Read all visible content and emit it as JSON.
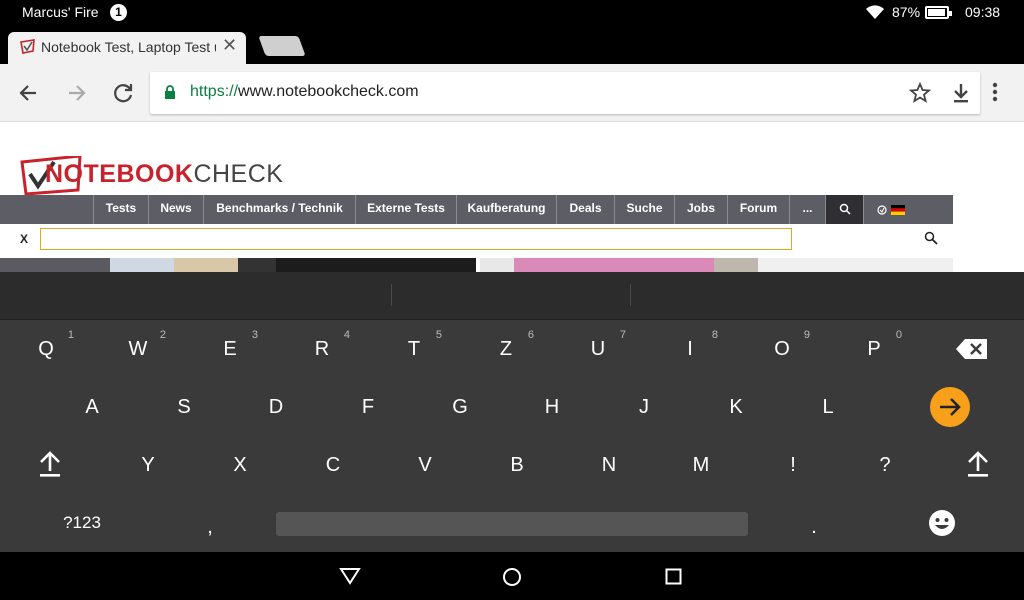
{
  "status_bar": {
    "device_name": "Marcus' Fire",
    "notification_count": "1",
    "battery": "87%",
    "time": "09:38"
  },
  "tabs": {
    "active_title": "Notebook Test, Laptop Test u",
    "close_symbol": "✕"
  },
  "toolbar": {
    "url_scheme": "https://",
    "url_host": "www.notebookcheck.com"
  },
  "site": {
    "logo_red": "NOTEBOOK",
    "logo_grey": "CHECK",
    "nav_items": [
      "Tests",
      "News",
      "Benchmarks / Technik",
      "Externe Tests",
      "Kaufberatung",
      "Deals",
      "Suche",
      "Jobs",
      "Forum",
      "..."
    ],
    "search_close": "X",
    "search_value": ""
  },
  "keyboard": {
    "row1": [
      {
        "key": "Q",
        "num": "1"
      },
      {
        "key": "W",
        "num": "2"
      },
      {
        "key": "E",
        "num": "3"
      },
      {
        "key": "R",
        "num": "4"
      },
      {
        "key": "T",
        "num": "5"
      },
      {
        "key": "Z",
        "num": "6"
      },
      {
        "key": "U",
        "num": "7"
      },
      {
        "key": "I",
        "num": "8"
      },
      {
        "key": "O",
        "num": "9"
      },
      {
        "key": "P",
        "num": "0"
      }
    ],
    "row2": [
      "A",
      "S",
      "D",
      "F",
      "G",
      "H",
      "J",
      "K",
      "L"
    ],
    "row3": [
      "Y",
      "X",
      "C",
      "V",
      "B",
      "N",
      "M",
      "!",
      "?"
    ],
    "symbols_label": "?123",
    "comma": ",",
    "period": "."
  },
  "colors": {
    "accent_enter": "#f9a01b",
    "url_scheme": "#0b8043",
    "logo_red": "#c8232c"
  }
}
